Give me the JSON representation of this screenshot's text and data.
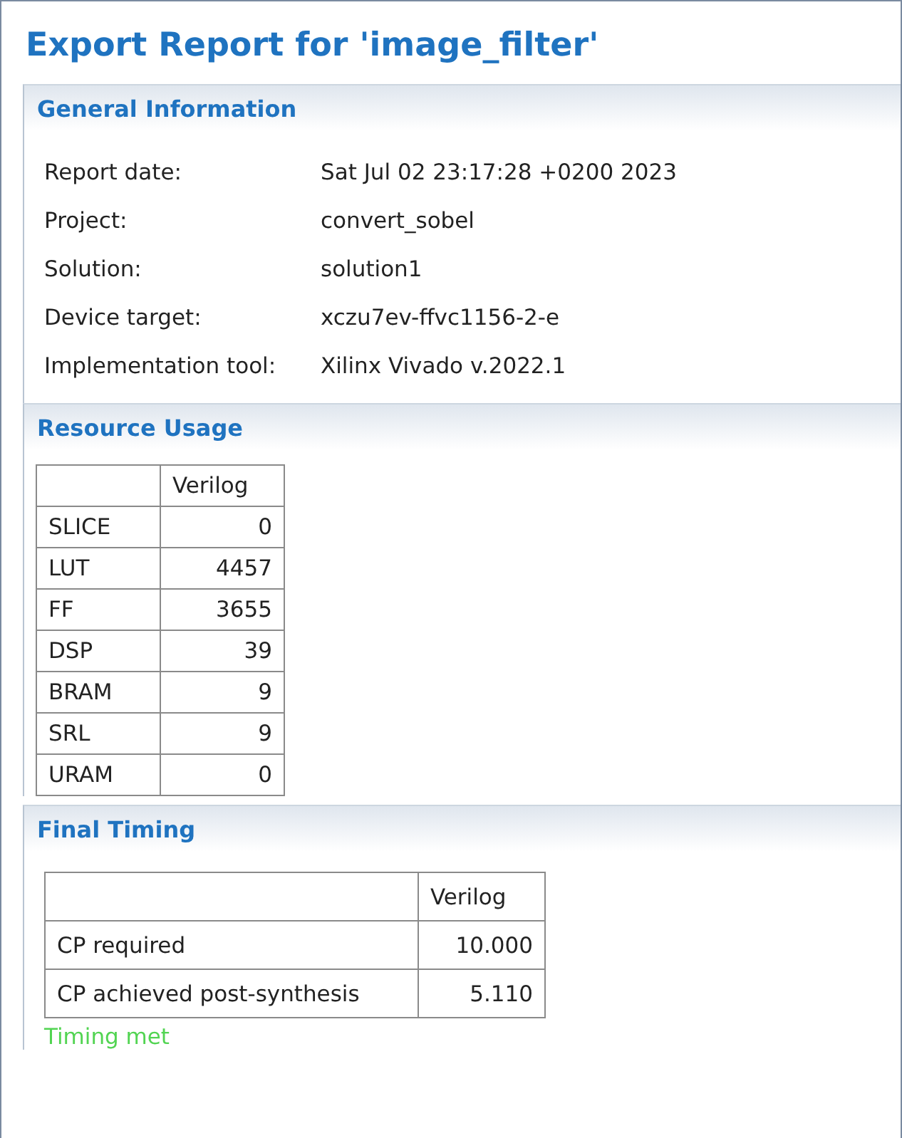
{
  "title": "Export Report for 'image_filter'",
  "sections": [
    {
      "kind": "fields",
      "heading": "General Information",
      "fields": [
        {
          "label": "Report date:",
          "value": "Sat Jul 02 23:17:28 +0200 2023"
        },
        {
          "label": "Project:",
          "value": "convert_sobel"
        },
        {
          "label": "Solution:",
          "value": "solution1"
        },
        {
          "label": "Device target:",
          "value": "xczu7ev-ffvc1156-2-e"
        },
        {
          "label": "Implementation tool:",
          "value": "Xilinx Vivado v.2022.1"
        }
      ]
    },
    {
      "kind": "table",
      "heading": "Resource Usage",
      "columns": [
        "Verilog"
      ],
      "rows": [
        {
          "name": "SLICE",
          "values": [
            "0"
          ]
        },
        {
          "name": "LUT",
          "values": [
            "4457"
          ]
        },
        {
          "name": "FF",
          "values": [
            "3655"
          ]
        },
        {
          "name": "DSP",
          "values": [
            "39"
          ]
        },
        {
          "name": "BRAM",
          "values": [
            "9"
          ]
        },
        {
          "name": "SRL",
          "values": [
            "9"
          ]
        },
        {
          "name": "URAM",
          "values": [
            "0"
          ]
        }
      ]
    },
    {
      "kind": "table",
      "heading": "Final Timing",
      "columns": [
        "Verilog"
      ],
      "rows": [
        {
          "name": "CP required",
          "values": [
            "10.000"
          ]
        },
        {
          "name": "CP achieved post-synthesis",
          "values": [
            "5.110"
          ]
        }
      ],
      "status": {
        "text": "Timing met",
        "met": true
      }
    }
  ]
}
